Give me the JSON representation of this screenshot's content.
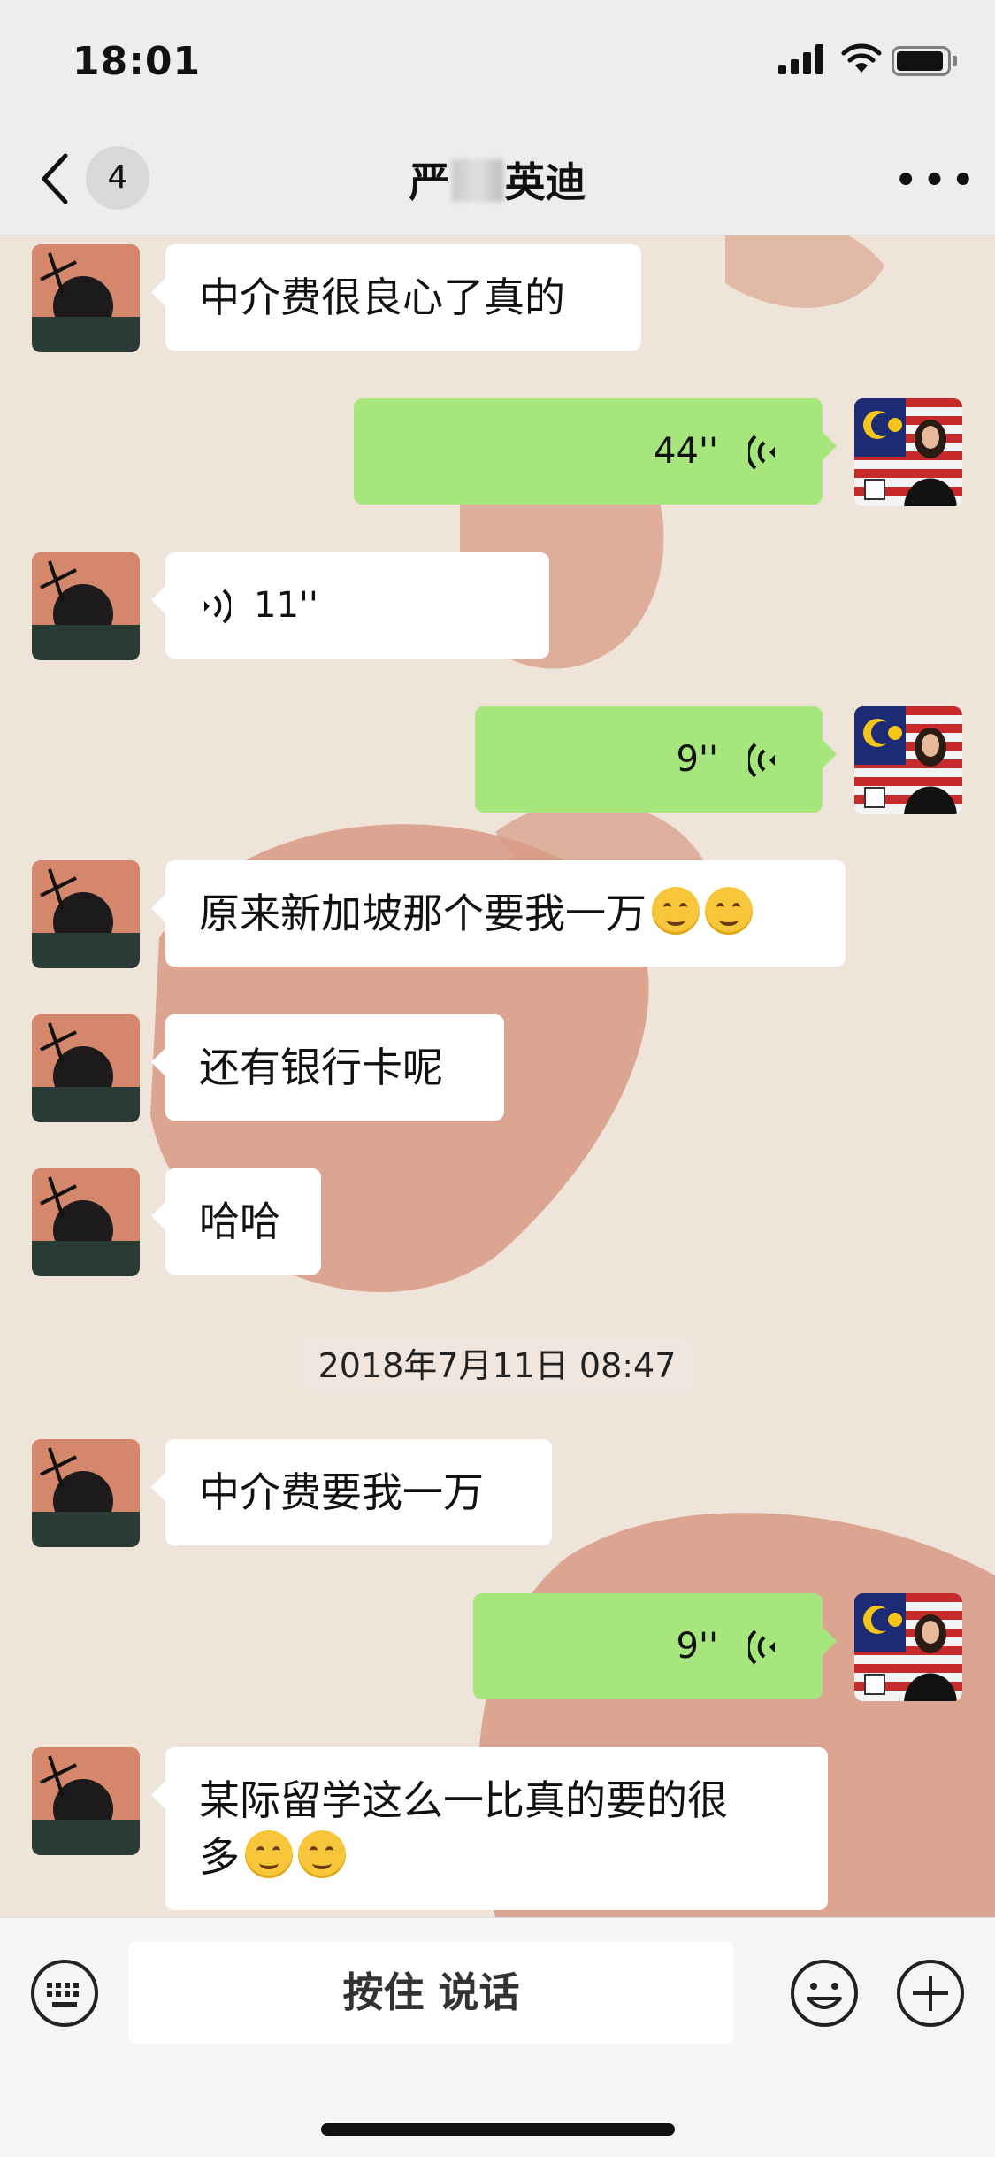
{
  "status_bar": {
    "time": "18:01"
  },
  "header": {
    "back_badge": "4",
    "title_left": "严",
    "title_right": "英迪",
    "more": "•••"
  },
  "messages": [
    {
      "side": "in",
      "type": "text",
      "text": "中介费很良心了真的"
    },
    {
      "side": "out",
      "type": "voice",
      "duration": "44''"
    },
    {
      "side": "in",
      "type": "voice",
      "duration": "11''"
    },
    {
      "side": "out",
      "type": "voice",
      "duration": "9''"
    },
    {
      "side": "in",
      "type": "text",
      "text": "原来新加坡那个要我一万",
      "emoji_count": 2
    },
    {
      "side": "in",
      "type": "text",
      "text": "还有银行卡呢"
    },
    {
      "side": "in",
      "type": "text",
      "text": "哈哈"
    },
    {
      "side": "in",
      "type": "text",
      "text": "中介费要我一万"
    },
    {
      "side": "out",
      "type": "voice",
      "duration": "9''"
    },
    {
      "side": "in",
      "type": "text",
      "line1": "某际留学这么一比真的要的很",
      "line2": "多",
      "emoji_count": 2
    }
  ],
  "timestamp": "2018年7月11日 08:47",
  "input_bar": {
    "hold_to_talk": "按住 说话"
  },
  "colors": {
    "out_bubble": "#a6e67d",
    "in_bubble": "#ffffff",
    "bar_bg": "#ededed"
  }
}
